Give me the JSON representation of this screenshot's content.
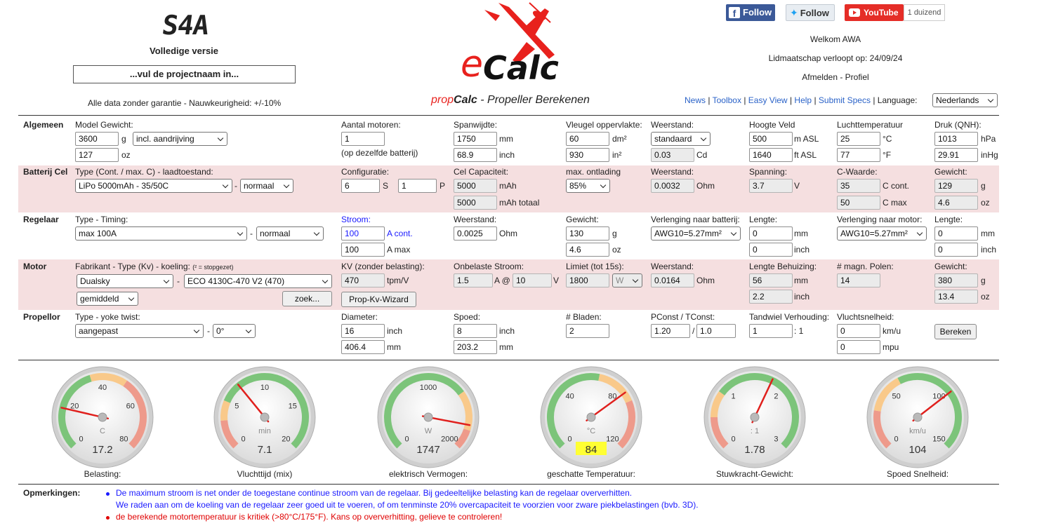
{
  "header": {
    "version_logo": "S4A",
    "version": "Volledige versie",
    "project_name": "...vul de projectnaam in...",
    "disclaimer": "Alle data zonder garantie - Nauwkeurigheid: +/-10%",
    "brand_e": "e",
    "brand_calc": "Calc",
    "subtitle_prop": "prop",
    "subtitle_calc": "Calc",
    "subtitle_rest": " - Propeller Berekenen",
    "social": {
      "facebook": "Follow",
      "twitter": "Follow",
      "youtube": "YouTube",
      "youtube_count": "1 duizend"
    },
    "welcome": "Welkom AWA",
    "membership": "Lidmaatschap verloopt op: 24/09/24",
    "logout": "Afmelden",
    "profile_sep": " - ",
    "profile": "Profiel",
    "nav": {
      "news": "News",
      "toolbox": "Toolbox",
      "easy_view": "Easy View",
      "help": "Help",
      "submit_specs": "Submit Specs",
      "language_label": "Language:",
      "language_value": "Nederlands",
      "sep": "|"
    },
    "colors": {
      "brand_red": "#e8211d",
      "link_blue": "#2a62c8",
      "band_pink": "#f5dfe0"
    }
  },
  "general": {
    "section": "Algemeen",
    "weight_label": "Model Gewicht:",
    "weight_g": "3600",
    "unit_g": "g",
    "weight_mode": "incl. aandrijving",
    "weight_oz": "127",
    "unit_oz": "oz",
    "motors_label": "Aantal motoren:",
    "motors": "1",
    "motors_note": "(op dezelfde batterij)",
    "span_label": "Spanwijdte:",
    "span_mm": "1750",
    "unit_mm": "mm",
    "span_inch": "68.9",
    "unit_inch": "inch",
    "wing_label": "Vleugel oppervlakte:",
    "wing_dm2": "60",
    "unit_dm2": "dm²",
    "wing_in2": "930",
    "unit_in2": "in²",
    "drag_label": "Weerstand:",
    "drag_mode": "standaard",
    "drag_cd": "0.03",
    "unit_cd": "Cd",
    "elev_label": "Hoogte Veld",
    "elev_m": "500",
    "unit_masl": "m ASL",
    "elev_ft": "1640",
    "unit_ftasl": "ft ASL",
    "temp_label": "Luchttemperatuur",
    "temp_c": "25",
    "unit_c": "°C",
    "temp_f": "77",
    "unit_f": "°F",
    "press_label": "Druk (QNH):",
    "press_hpa": "1013",
    "unit_hpa": "hPa",
    "press_inhg": "29.91",
    "unit_inhg": "inHg"
  },
  "battery": {
    "section": "Batterij Cel",
    "type_label": "Type (Cont. / max. C) - laadtoestand:",
    "type": "LiPo 5000mAh - 35/50C",
    "dash": "-",
    "charge": "normaal",
    "config_label": "Configuratie:",
    "series": "6",
    "unit_s": "S",
    "parallel": "1",
    "unit_p": "P",
    "cap_label": "Cel Capaciteit:",
    "cap": "5000",
    "unit_mah": "mAh",
    "cap_total": "5000",
    "unit_mah_total": "mAh totaal",
    "discharge_label": "max. ontlading",
    "discharge": "85%",
    "res_label": "Weerstand:",
    "res": "0.0032",
    "unit_ohm": "Ohm",
    "volt_label": "Spanning:",
    "volt": "3.7",
    "unit_v": "V",
    "c_label": "C-Waarde:",
    "c_cont": "35",
    "unit_c_cont": "C cont.",
    "c_max": "50",
    "unit_c_max": "C max",
    "weight_label": "Gewicht:",
    "weight_g": "129",
    "unit_g": "g",
    "weight_oz": "4.6",
    "unit_oz": "oz"
  },
  "esc": {
    "section": "Regelaar",
    "type_label": "Type - Timing:",
    "type": "max 100A",
    "dash": "-",
    "timing": "normaal",
    "current_label": "Stroom:",
    "cont": "100",
    "unit_cont": "A cont.",
    "max": "100",
    "unit_max": "A max",
    "res_label": "Weerstand:",
    "res": "0.0025",
    "unit_ohm": "Ohm",
    "weight_label": "Gewicht:",
    "weight_g": "130",
    "unit_g": "g",
    "weight_oz": "4.6",
    "unit_oz": "oz",
    "ext_batt_label": "Verlenging naar batterij:",
    "ext_batt": "AWG10=5.27mm²",
    "len1_label": "Lengte:",
    "len1_mm": "0",
    "unit_mm": "mm",
    "len1_inch": "0",
    "unit_inch": "inch",
    "ext_motor_label": "Verlenging naar motor:",
    "ext_motor": "AWG10=5.27mm²",
    "len2_label": "Lengte:",
    "len2_mm": "0",
    "len2_inch": "0"
  },
  "motor": {
    "section": "Motor",
    "type_label": "Fabrikant - Type (Kv) - koeling:",
    "type_note": "(² = stopgezet)",
    "maker": "Dualsky",
    "dash": "-",
    "model": "ECO 4130C-470 V2 (470)",
    "cooling": "gemiddeld",
    "search": "zoek...",
    "kv_label": "KV (zonder belasting):",
    "kv": "470",
    "unit_kv": "tpm/V",
    "wizard": "Prop-Kv-Wizard",
    "noload_label": "Onbelaste Stroom:",
    "noload_a": "1.5",
    "unit_a_at": "A @",
    "noload_v": "10",
    "unit_v": "V",
    "limit_label": "Limiet (tot 15s):",
    "limit": "1800",
    "limit_unit": "W",
    "res_label": "Weerstand:",
    "res": "0.0164",
    "unit_ohm": "Ohm",
    "case_label": "Lengte Behuizing:",
    "case_mm": "56",
    "unit_mm": "mm",
    "case_inch": "2.2",
    "unit_inch": "inch",
    "poles_label": "# magn. Polen:",
    "poles": "14",
    "weight_label": "Gewicht:",
    "weight_g": "380",
    "unit_g": "g",
    "weight_oz": "13.4",
    "unit_oz": "oz"
  },
  "propeller": {
    "section": "Propellor",
    "type_label": "Type - yoke twist:",
    "type": "aangepast",
    "dash": "-",
    "twist": "0°",
    "dia_label": "Diameter:",
    "dia_inch": "16",
    "unit_inch": "inch",
    "dia_mm": "406.4",
    "unit_mm": "mm",
    "pitch_label": "Spoed:",
    "pitch_inch": "8",
    "pitch_mm": "203.2",
    "blades_label": "# Bladen:",
    "blades": "2",
    "pconst_label": "PConst / TConst:",
    "pconst": "1.20",
    "slash": "/",
    "tconst": "1.0",
    "gear_label": "Tandwiel Verhouding:",
    "gear": "1",
    "gear_suffix": ": 1",
    "speed_label": "Vluchtsnelheid:",
    "speed_kmh": "0",
    "unit_kmh": "km/u",
    "speed_mph": "0",
    "unit_mph": "mpu",
    "calc": "Bereken"
  },
  "gauges": [
    {
      "caption": "Belasting:",
      "unit": "C",
      "value": "17.2",
      "needle": 17.2,
      "min": 0,
      "max": 80,
      "ticks": [
        "0",
        "20",
        "40",
        "60",
        "80"
      ],
      "warn_from": 35,
      "danger_from": 50,
      "reverse": false,
      "highlight": false
    },
    {
      "caption": "Vluchttijd (mix)",
      "unit": "min",
      "value": "7.1",
      "needle": 7.1,
      "min": 0,
      "max": 20,
      "ticks": [
        "0",
        "5",
        "10",
        "15",
        "20"
      ],
      "warn_from": 5,
      "danger_from": 3,
      "reverse": true,
      "highlight": false
    },
    {
      "caption": "elektrisch Vermogen:",
      "unit": "W",
      "value": "1747",
      "needle": 1747,
      "min": 0,
      "max": 2000,
      "ticks": [
        "0",
        "1000",
        "2000"
      ],
      "warn_from": 1400,
      "danger_from": 1800,
      "reverse": false,
      "highlight": false
    },
    {
      "caption": "geschatte Temperatuur:",
      "unit": "°C",
      "value": "84",
      "needle": 84,
      "min": 0,
      "max": 120,
      "ticks": [
        "0",
        "40",
        "80",
        "120"
      ],
      "warn_from": 65,
      "danger_from": 90,
      "reverse": false,
      "highlight": true
    },
    {
      "caption": "Stuwkracht-Gewicht:",
      "unit": ": 1",
      "value": "1.78",
      "needle": 1.78,
      "min": 0,
      "max": 3,
      "ticks": [
        "0",
        "1",
        "2",
        "3"
      ],
      "warn_from": 0.9,
      "danger_from": 0.5,
      "reverse": true,
      "highlight": false
    },
    {
      "caption": "Spoed Snelheid:",
      "unit": "km/u",
      "value": "104",
      "needle": 104,
      "min": 0,
      "max": 150,
      "ticks": [
        "0",
        "50",
        "100",
        "150"
      ],
      "warn_from": 60,
      "danger_from": 30,
      "reverse": true,
      "highlight": false
    }
  ],
  "remarks": {
    "label": "Opmerkingen:",
    "items": [
      {
        "text": "De maximum stroom is net onder de toegestane continue stroom van de regelaar. Bij gedeeltelijke belasting kan de regelaar oververhitten.",
        "color": "#1a1aff"
      },
      {
        "text": "We raden aan om de koeling van de regelaar zeer goed uit te voeren, of om tenminste 20% overcapaciteit te voorzien voor zware piekbelastingen (bvb. 3D).",
        "color": "#1a1aff"
      },
      {
        "text": "de berekende motortemperatuur is kritiek (>80°C/175°F). Kans op oververhitting, gelieve te controleren!",
        "color": "#e00000"
      }
    ]
  }
}
